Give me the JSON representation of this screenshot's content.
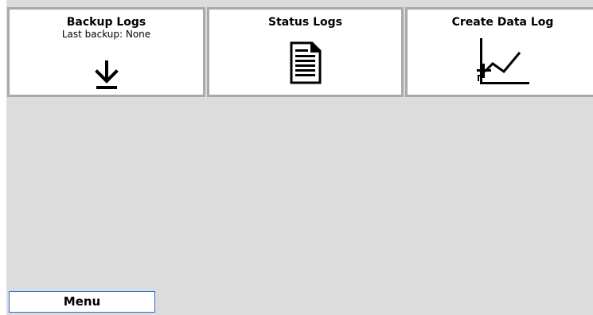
{
  "tiles": {
    "backup_logs": {
      "title": "Backup Logs",
      "subtitle": "Last backup: None",
      "icon": "download-icon"
    },
    "status_logs": {
      "title": "Status Logs",
      "icon": "document-icon"
    },
    "create_data_log": {
      "title": "Create Data Log",
      "icon": "add-chart-icon"
    }
  },
  "footer": {
    "menu_label": "Menu"
  },
  "colors": {
    "background": "#dcdcdc",
    "tile_border": "#a9a9a9",
    "menu_border": "#2a6fd6"
  }
}
